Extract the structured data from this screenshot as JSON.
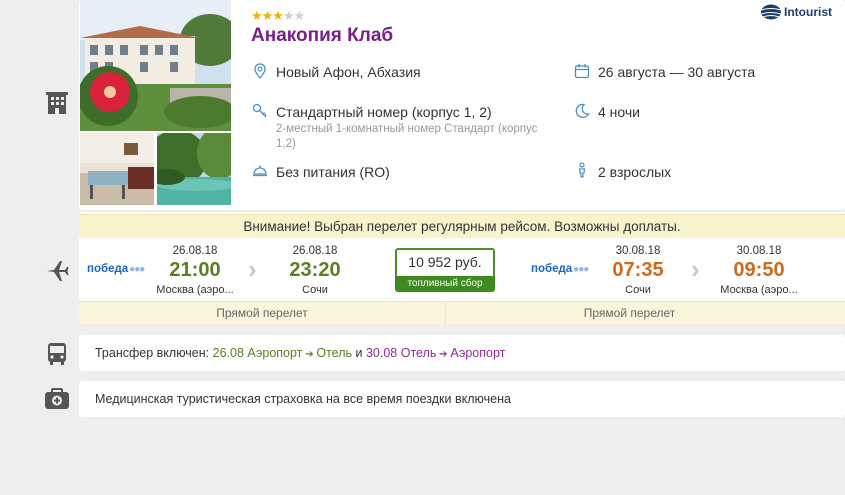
{
  "hotel": {
    "stars_on": "★★★",
    "stars_off": "★★",
    "name": "Анакопия Клаб",
    "brand": "Intourist",
    "location": "Новый Афон, Абхазия",
    "dates": "26 августа — 30 августа",
    "room": "Стандартный номер (корпус 1, 2)",
    "room_desc_1": "2-местный 1-комнатный номер Стандарт (корпус",
    "room_desc_2": "1,2)",
    "nights": "4 ночи",
    "meal": "Без питания (RO)",
    "guests": "2 взрослых"
  },
  "flight": {
    "warning": "Внимание! Выбран перелет регулярным рейсом. Возможны доплаты.",
    "outbound": {
      "airline": "победа",
      "dep_date": "26.08.18",
      "dep_time": "21:00",
      "dep_city": "Москва (аэро...",
      "arr_date": "26.08.18",
      "arr_time": "23:20",
      "arr_city": "Сочи",
      "direct": "Прямой перелет"
    },
    "inbound": {
      "airline": "победа",
      "dep_date": "30.08.18",
      "dep_time": "07:35",
      "dep_city": "Сочи",
      "arr_date": "30.08.18",
      "arr_time": "09:50",
      "arr_city": "Москва (аэро...",
      "direct": "Прямой перелет"
    },
    "price": "10 952 руб.",
    "price_note": "топливный сбор"
  },
  "transfer": {
    "prefix": "Трансфер включен:",
    "leg1_date": "26.08",
    "leg1_from": "Аэропорт",
    "leg1_to": "Отель",
    "joiner": "и",
    "leg2_date": "30.08",
    "leg2_from": "Отель",
    "leg2_to": "Аэропорт"
  },
  "insurance": {
    "text": "Медицинская туристическая страховка на все время поездки включена"
  },
  "colors": {
    "hotel_title": "#7a1f8f",
    "price_border": "#4a8f2b",
    "time_out": "#5b7f1f",
    "time_in": "#d06a1a"
  }
}
